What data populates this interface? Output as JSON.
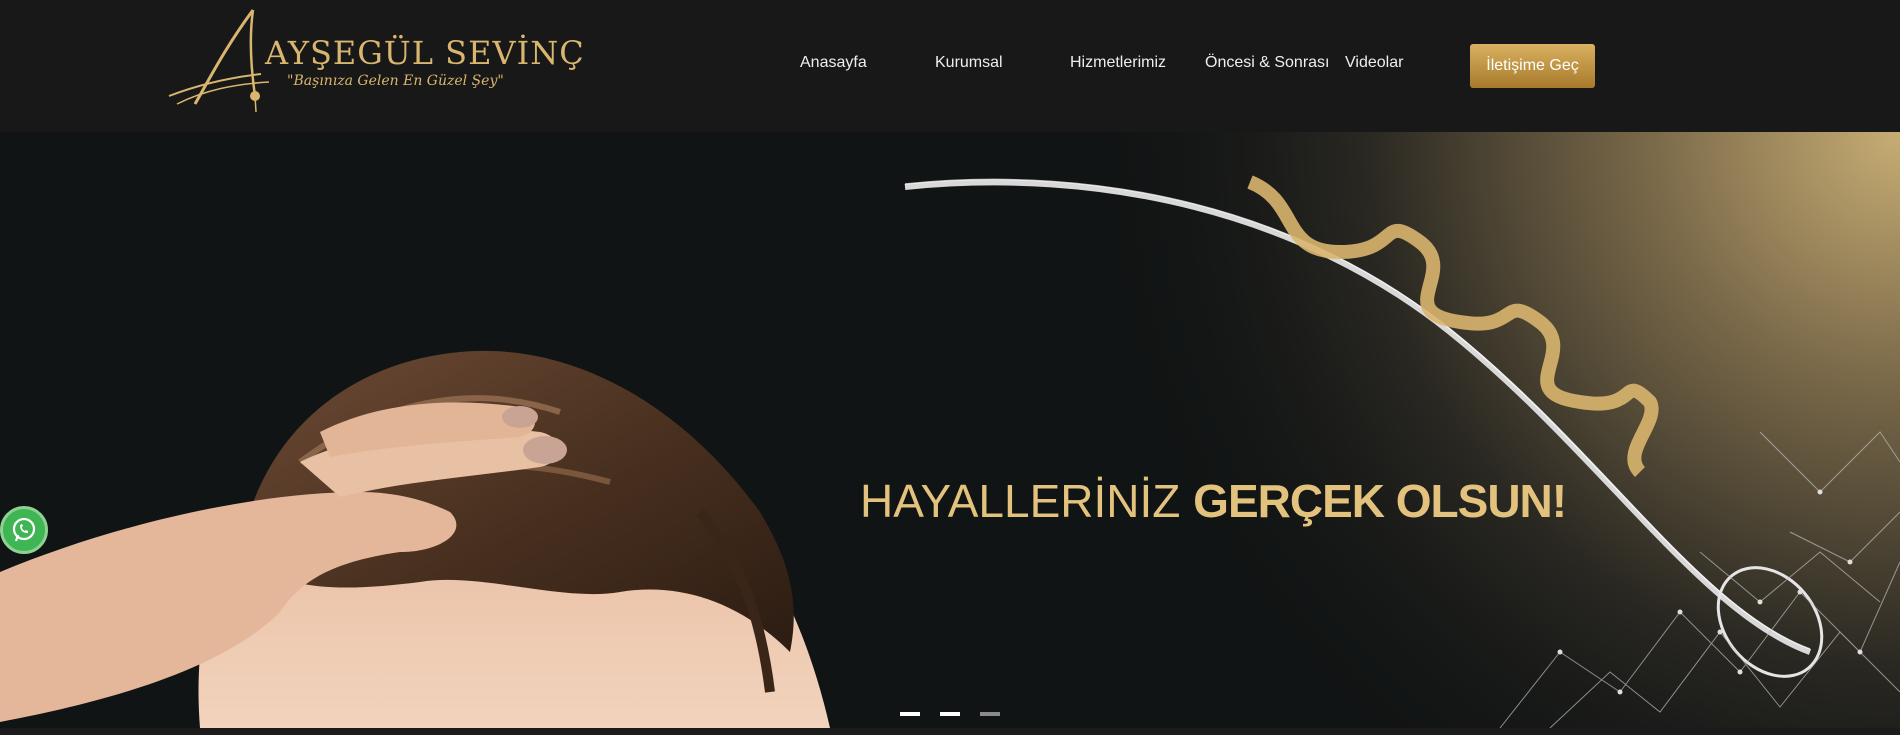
{
  "header": {
    "logo": {
      "name": "AYŞEGÜL SEVİNÇ",
      "tagline": "\"Başınıza Gelen En Güzel Şey\"",
      "icon": "hair-monogram-icon"
    },
    "nav": [
      {
        "label": "Anasayfa"
      },
      {
        "label": "Kurumsal"
      },
      {
        "label": "Hizmetlerimiz"
      },
      {
        "label": "Öncesi & Sonrası"
      },
      {
        "label": "Videolar"
      }
    ],
    "cta_label": "İletişime Geç"
  },
  "hero": {
    "slogan_regular": "HAYALLERİNİZ",
    "slogan_bold": "GERÇEK OLSUN!",
    "slides_total": 3,
    "active_slide": 3,
    "images": [
      "man-touching-hair",
      "hair-strand-helix-illustration"
    ]
  },
  "floating": {
    "whatsapp_icon": "whatsapp-icon"
  },
  "colors": {
    "header_bg": "#181818",
    "hero_bg": "#111414",
    "gold": "#e2c27d",
    "cta_gradient": [
      "#d9b160",
      "#a77a2b"
    ],
    "whatsapp": "#3fb553"
  }
}
